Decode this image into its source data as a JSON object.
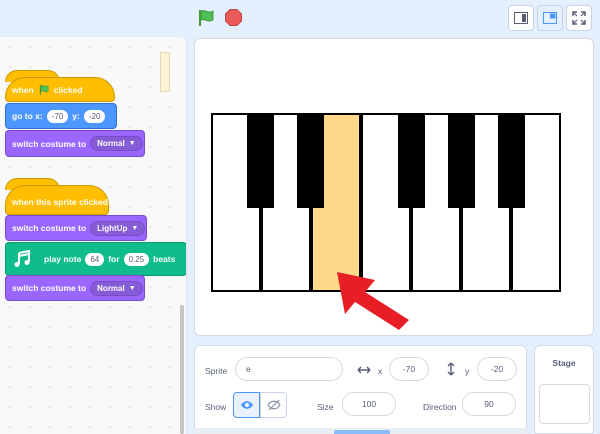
{
  "toolbar": {
    "green_flag_icon": "green-flag-icon",
    "stop_icon": "stop-icon"
  },
  "code": {
    "script1": {
      "hat_when": "when",
      "hat_clicked": "clicked",
      "goto_label": "go to x:",
      "goto_x": "-70",
      "goto_y_label": "y:",
      "goto_y": "-20",
      "switch_label": "switch costume to",
      "switch_value": "Normal"
    },
    "script2": {
      "hat_label": "when this sprite clicked",
      "switch1_label": "switch costume to",
      "switch1_value": "LightUp",
      "play_label": "play note",
      "play_note": "64",
      "play_for": "for",
      "play_beats": "0.25",
      "play_beats_label": "beats",
      "switch2_label": "switch costume to",
      "switch2_value": "Normal"
    }
  },
  "sprite_info": {
    "sprite_label": "Sprite",
    "sprite_name": "e",
    "x_label": "x",
    "x_value": "-70",
    "y_label": "y",
    "y_value": "-20",
    "show_label": "Show",
    "size_label": "Size",
    "size_value": "100",
    "direction_label": "Direction",
    "direction_value": "90"
  },
  "stage_panel": {
    "title": "Stage"
  },
  "colors": {
    "events": "#ffbf00",
    "motion": "#4c97ff",
    "looks": "#9966ff",
    "music": "#0fbd8c",
    "lit_key": "#ffd889",
    "arrow": "#e81e26"
  }
}
